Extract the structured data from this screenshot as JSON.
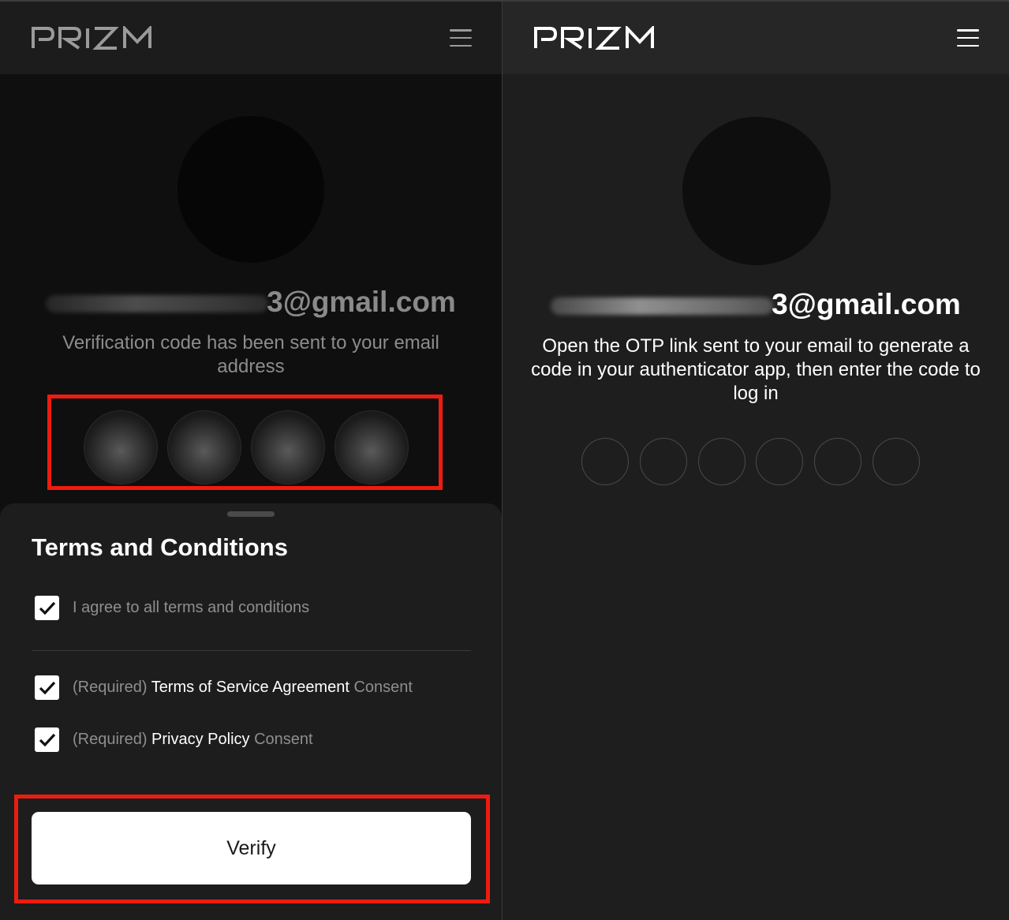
{
  "left_panel": {
    "header": {
      "logo_text": "PRIZM",
      "menu_icon": "hamburger-icon"
    },
    "email_visible_suffix": "3@gmail.com",
    "message": "Verification code has been sent to your email address",
    "code_digits_count": 4,
    "terms_sheet": {
      "title": "Terms and Conditions",
      "agree_all": {
        "label": "I agree to all terms and conditions",
        "checked": true
      },
      "items": [
        {
          "prefix": "(Required)",
          "name": "Terms of Service Agreement",
          "suffix": "Consent",
          "checked": true
        },
        {
          "prefix": "(Required)",
          "name": "Privacy Policy",
          "suffix": "Consent",
          "checked": true
        }
      ]
    },
    "verify_label": "Verify"
  },
  "right_panel": {
    "header": {
      "logo_text": "PRIZM",
      "menu_icon": "hamburger-icon"
    },
    "email_visible_suffix": "3@gmail.com",
    "message": "Open the OTP link sent to your email to generate a code in your authenticator app, then enter the code to log in",
    "otp_digits_count": 6
  },
  "colors": {
    "highlight": "#ee1c10",
    "left_background": "#0f0f0f",
    "right_background": "#1e1e1e",
    "sheet_background": "#1d1d1d",
    "button_background": "#ffffff"
  }
}
